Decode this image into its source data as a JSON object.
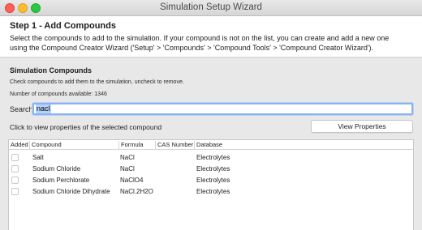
{
  "window": {
    "title": "Simulation Setup Wizard"
  },
  "header": {
    "step_title": "Step 1 - Add Compounds",
    "description_line1": "Select the compounds to add to the simulation. If your compound is not on the list, you can create and add a new one",
    "description_line2": "using the Compound Creator Wizard ('Setup' > 'Compounds' > 'Compound Tools' > 'Compound Creator Wizard')."
  },
  "compounds": {
    "section_title": "Simulation Compounds",
    "hint": "Check compounds to add them to the simulation, uncheck to remove.",
    "count_text": "Number of compounds available: 1346",
    "search_label": "Search",
    "search_value": "nacl",
    "click_hint": "Click to view properties of the selected compound",
    "view_properties_label": "View Properties"
  },
  "table": {
    "columns": [
      "Added",
      "Compound",
      "Formula",
      "CAS Number",
      "Database"
    ],
    "rows": [
      {
        "added": false,
        "compound": "Salt",
        "formula": "NaCl",
        "cas": "",
        "database": "Electrolytes"
      },
      {
        "added": false,
        "compound": "Sodium Chloride",
        "formula": "NaCl",
        "cas": "",
        "database": "Electrolytes"
      },
      {
        "added": false,
        "compound": "Sodium Perchlorate",
        "formula": "NaClO4",
        "cas": "",
        "database": "Electrolytes"
      },
      {
        "added": false,
        "compound": "Sodium Chloride Dihydrate",
        "formula": "NaCl.2H2O",
        "cas": "",
        "database": "Electrolytes"
      }
    ]
  },
  "colors": {
    "close": "#fe5f57",
    "minimize": "#febc2e",
    "maximize": "#28c840",
    "focus_ring": "#8ab2ee",
    "selection": "#b4d3fb"
  }
}
